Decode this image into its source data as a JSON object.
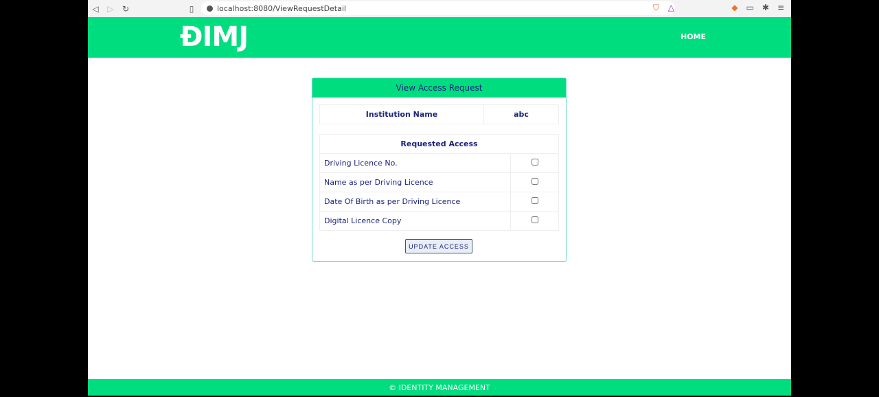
{
  "browser": {
    "url": "localhost:8080/ViewRequestDetail"
  },
  "header": {
    "logo": "ĐIMJ",
    "home": "HOME"
  },
  "card": {
    "title": "View Access Request",
    "institution_label": "Institution Name",
    "institution_value": "abc",
    "requested_header": "Requested Access",
    "items": [
      {
        "label": "Driving Licence No.",
        "checked": false
      },
      {
        "label": "Name as per Driving Licence",
        "checked": false
      },
      {
        "label": "Date Of Birth as per Driving Licence",
        "checked": false
      },
      {
        "label": "Digital Licence Copy",
        "checked": false
      }
    ],
    "update_button": "UPDATE ACCESS"
  },
  "footer": {
    "text": "© IDENTITY MANAGEMENT"
  },
  "colors": {
    "brand": "#00dd7f",
    "text": "#1a237e"
  }
}
